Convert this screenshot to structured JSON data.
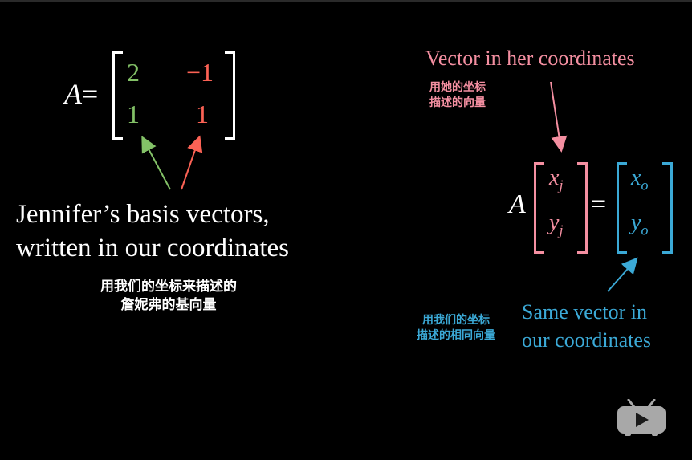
{
  "colors": {
    "background": "#000000",
    "text": "#ffffff",
    "green": "#83c167",
    "red": "#fc6255",
    "pink": "#f48fa1",
    "blue": "#3ba9d6",
    "player_gray": "#a8a8a8"
  },
  "left_matrix": {
    "label": "A",
    "equals": "=",
    "entries": {
      "r1c1": "2",
      "r1c2": "−1",
      "r2c1": "1",
      "r2c2": "1"
    }
  },
  "left_caption": {
    "line1": "Jennifer’s basis vectors,",
    "line2": "written in our coordinates",
    "cn_line1": "用我们的坐标来描述的",
    "cn_line2": "詹妮弗的基向量"
  },
  "right_equation": {
    "label": "A",
    "equals": "=",
    "left_vector": {
      "top_var": "x",
      "top_sub": "j",
      "bottom_var": "y",
      "bottom_sub": "j"
    },
    "right_vector": {
      "top_var": "x",
      "top_sub": "o",
      "bottom_var": "y",
      "bottom_sub": "o"
    }
  },
  "her_annotation": {
    "title": "Vector in her coordinates",
    "cn_line1": "用她的坐标",
    "cn_line2": "描述的向量"
  },
  "our_annotation": {
    "title_line1": "Same vector in",
    "title_line2": "our coordinates",
    "cn_line1": "用我们的坐标",
    "cn_line2": "描述的相同向量"
  },
  "player": {
    "icon": "play-tv-icon"
  }
}
